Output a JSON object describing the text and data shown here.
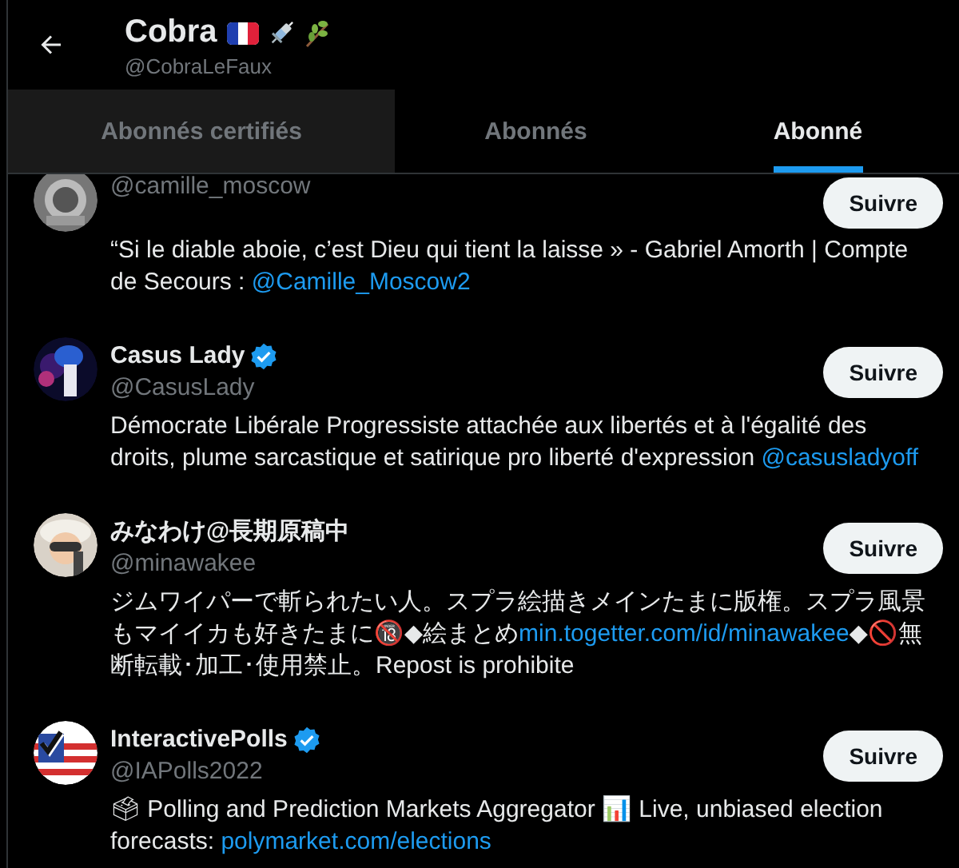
{
  "header": {
    "title": "Cobra",
    "handle": "@CobraLeFaux"
  },
  "tabs": [
    {
      "label": "Abonnés certifiés",
      "selected": false,
      "hovered": true
    },
    {
      "label": "Abonnés",
      "selected": false,
      "hovered": false
    },
    {
      "label": "Abonné",
      "selected": true,
      "hovered": false
    }
  ],
  "users": [
    {
      "verified": false,
      "handle": "@camille_moscow",
      "button": "Suivre",
      "bio": [
        {
          "kind": "text",
          "text": "“Si le diable aboie, c’est Dieu qui tient la laisse » - Gabriel Amorth | Compte de Secours : "
        },
        {
          "kind": "link",
          "text": "@Camille_Moscow2"
        }
      ]
    },
    {
      "name": "Casus Lady",
      "verified": true,
      "handle": "@CasusLady",
      "button": "Suivre",
      "bio": [
        {
          "kind": "text",
          "text": "Démocrate Libérale Progressiste attachée aux libertés et à l'égalité des droits, plume sarcastique et satirique pro liberté d'expression "
        },
        {
          "kind": "link",
          "text": "@casusladyoff"
        }
      ]
    },
    {
      "name": "みなわけ@長期原稿中",
      "verified": false,
      "handle": "@minawakee",
      "button": "Suivre",
      "bio": [
        {
          "kind": "text",
          "text": "ジムワイパーで斬られたい人。スプラ絵描きメインたまに版権。スプラ風景もマイイカも好きたまに🔞◆絵まとめ"
        },
        {
          "kind": "link",
          "text": "min.togetter.com/id/minawakee"
        },
        {
          "kind": "text",
          "text": "◆🚫無断転載･加工･使用禁止。Repost is prohibite"
        }
      ]
    },
    {
      "name": "InteractivePolls",
      "verified": true,
      "handle": "@IAPolls2022",
      "button": "Suivre",
      "bio": [
        {
          "kind": "text",
          "text": "🗳 Polling and Prediction Markets Aggregator 📊 Live, unbiased election forecasts: "
        },
        {
          "kind": "link",
          "text": "polymarket.com/elections"
        }
      ]
    }
  ]
}
